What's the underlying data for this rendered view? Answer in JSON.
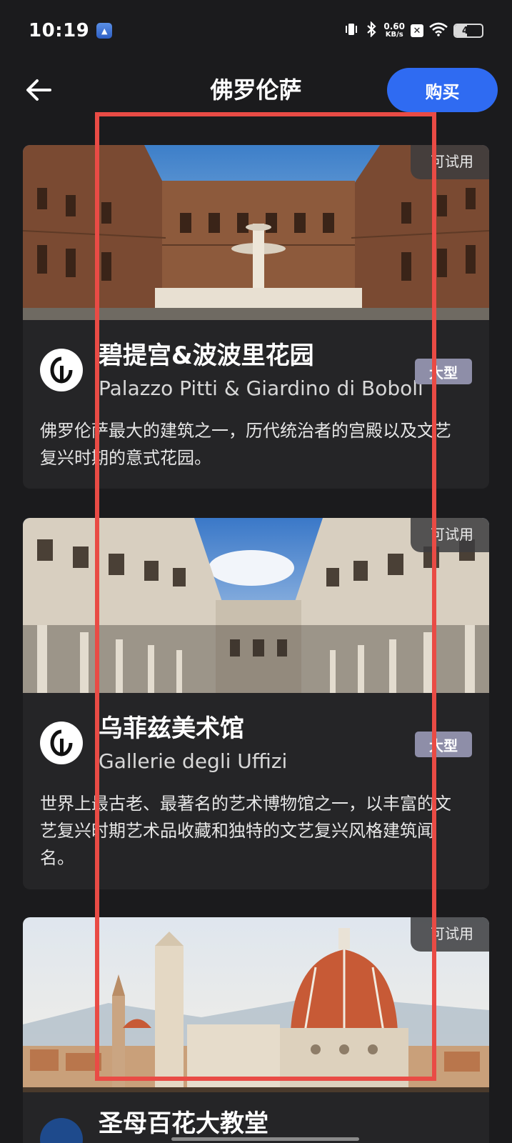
{
  "status_bar": {
    "time": "10:19",
    "network_speed_value": "0.60",
    "network_speed_unit": "KB/s",
    "battery_level": "46",
    "icons": [
      "vibrate-icon",
      "bluetooth-icon",
      "close-box-icon",
      "wifi-icon",
      "battery-icon"
    ]
  },
  "header": {
    "title": "佛罗伦萨",
    "buy_label": "购买"
  },
  "cards": [
    {
      "trial_label": "可试用",
      "title": "碧提宫&波波里花园",
      "subtitle": "Palazzo Pitti & Giardino di Boboli",
      "tag": "大型",
      "description": "佛罗伦萨最大的建筑之一，历代统治者的宫殿以及文艺复兴时期的意式花园。"
    },
    {
      "trial_label": "可试用",
      "title": "乌菲兹美术馆",
      "subtitle": "Gallerie degli Uffizi",
      "tag": "大型",
      "description": "世界上最古老、最著名的艺术博物馆之一，以丰富的文艺复兴时期艺术品收藏和独特的文艺复兴风格建筑闻名。"
    },
    {
      "trial_label": "可试用",
      "title": "圣母百花大教堂"
    }
  ],
  "colors": {
    "background": "#1b1b1d",
    "card": "#252527",
    "accent": "#2f6bf2",
    "tag": "#8e8ea8",
    "highlight": "#e94b45"
  }
}
